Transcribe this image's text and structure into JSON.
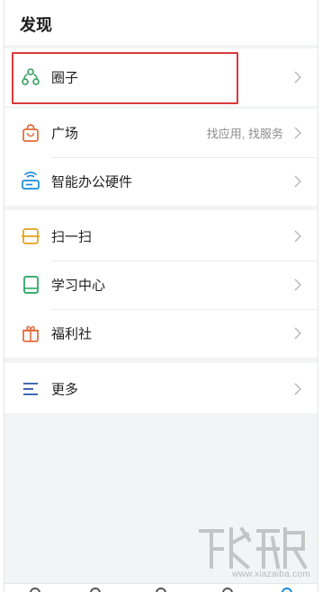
{
  "header": {
    "title": "发现"
  },
  "items": [
    {
      "label": "圈子",
      "icon": "circle-group-icon",
      "color": "#2e9e5b",
      "hint": ""
    },
    {
      "label": "广场",
      "icon": "shopping-bag-icon",
      "color": "#e36b3a",
      "hint": "找应用, 找服务"
    },
    {
      "label": "智能办公硬件",
      "icon": "router-device-icon",
      "color": "#1a8ad6",
      "hint": ""
    },
    {
      "label": "扫一扫",
      "icon": "scan-icon",
      "color": "#e0a21a",
      "hint": ""
    },
    {
      "label": "学习中心",
      "icon": "book-icon",
      "color": "#23a35d",
      "hint": ""
    },
    {
      "label": "福利社",
      "icon": "gift-icon",
      "color": "#e36b3a",
      "hint": ""
    },
    {
      "label": "更多",
      "icon": "menu-lines-icon",
      "color": "#2b5aa8",
      "hint": ""
    }
  ],
  "watermark": {
    "text": "www.xiazaiba.com"
  },
  "colors": {
    "highlight": "#d93a3a",
    "background": "#f3f4f6"
  }
}
